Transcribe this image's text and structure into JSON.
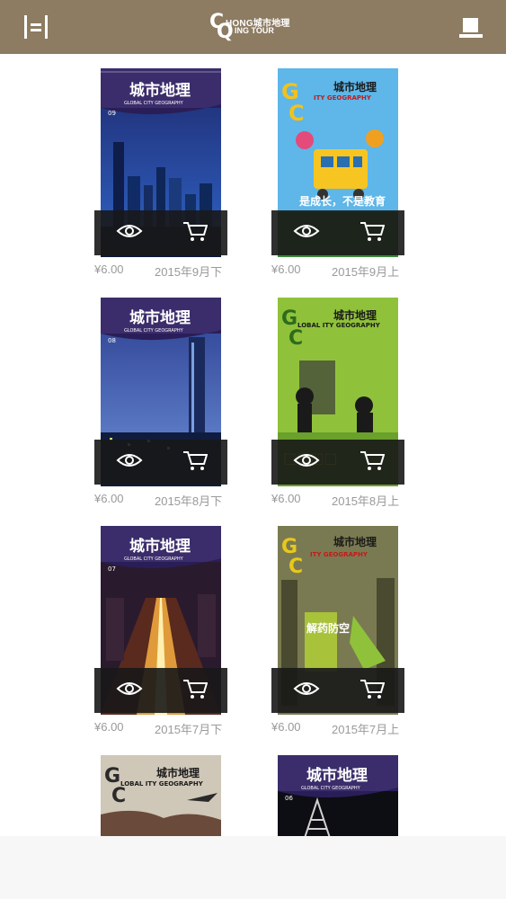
{
  "header": {
    "menu_icon": "sidebar-menu-icon",
    "logo": {
      "big_letters_1": "C",
      "big_letters_2": "Q",
      "line1": "HONG城市地理",
      "line2": "ING TOUR"
    },
    "bookshelf_icon": "bookshelf-icon",
    "background_color": "#8d7c62"
  },
  "magazines": [
    {
      "title_cn": "城市地理",
      "subtitle_en": "GLOBAL CITY GEOGRAPHY",
      "issue": "09",
      "cover_headline": "",
      "price": "¥6.00",
      "date": "2015年9月下"
    },
    {
      "title_cn": "城市地理",
      "subtitle_en": "ITY GEOGRAPHY",
      "issue": "",
      "cover_headline": "是成长，不是教育",
      "price": "¥6.00",
      "date": "2015年9月上"
    },
    {
      "title_cn": "城市地理",
      "subtitle_en": "GLOBAL CITY GEOGRAPHY",
      "issue": "08",
      "cover_headline": "",
      "price": "¥6.00",
      "date": "2015年8月下"
    },
    {
      "title_cn": "城市地理",
      "subtitle_en": "LOBAL ITY GEOGRAPHY",
      "issue": "",
      "cover_headline": "",
      "price": "¥6.00",
      "date": "2015年8月上"
    },
    {
      "title_cn": "城市地理",
      "subtitle_en": "GLOBAL CITY GEOGRAPHY",
      "issue": "07",
      "cover_headline": "",
      "price": "¥6.00",
      "date": "2015年7月下"
    },
    {
      "title_cn": "城市地理",
      "subtitle_en": "ITY GEOGRAPHY",
      "issue": "",
      "cover_headline": "解药防空",
      "price": "¥6.00",
      "date": "2015年7月上"
    },
    {
      "title_cn": "城市地理",
      "subtitle_en": "LOBAL ITY GEOGRAPHY",
      "issue": "",
      "cover_headline": "",
      "price": "",
      "date": ""
    },
    {
      "title_cn": "城市地理",
      "subtitle_en": "GLOBAL CITY GEOGRAPHY",
      "issue": "06",
      "cover_headline": "",
      "price": "",
      "date": ""
    }
  ],
  "action_icons": {
    "preview": "eye-icon",
    "buy": "cart-icon"
  }
}
